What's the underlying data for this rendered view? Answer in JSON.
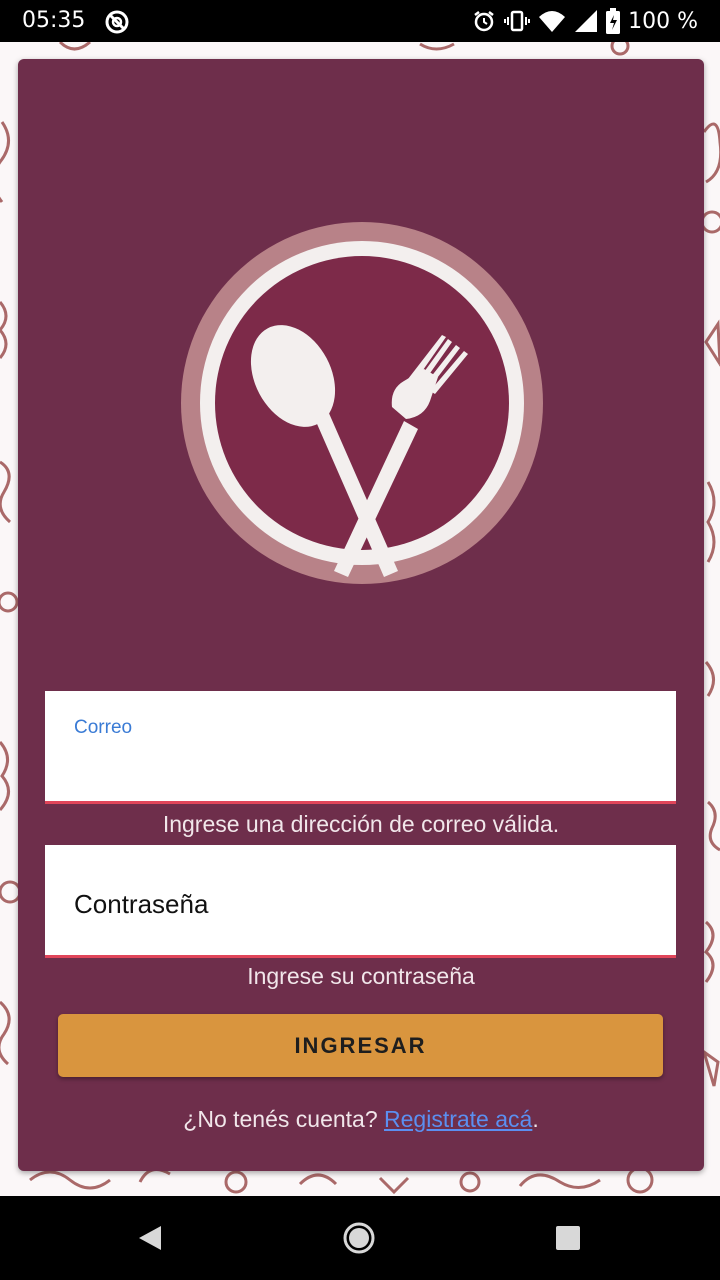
{
  "status_bar": {
    "time": "05:35",
    "battery_text": "100 %",
    "icons": [
      "do-not-disturb-icon",
      "alarm-icon",
      "vibrate-icon",
      "wifi-icon",
      "signal-icon",
      "battery-icon"
    ]
  },
  "logo": {
    "icon": "spoon-fork-plate-icon"
  },
  "form": {
    "email": {
      "label": "Correo",
      "value": "",
      "error": "Ingrese una dirección de correo válida."
    },
    "password": {
      "label": "Contraseña",
      "value": "",
      "error": "Ingrese su contraseña"
    },
    "login_button": "INGRESAR",
    "register_prompt": "¿No tenés cuenta? ",
    "register_link": "Registrate acá",
    "register_suffix": "."
  },
  "nav_bar": {
    "icons": [
      "back-icon",
      "home-icon",
      "recents-icon"
    ]
  },
  "colors": {
    "card": "#6e2e4b",
    "accent_button": "#d9953e",
    "label_blue": "#3a7bd5",
    "error_underline": "#e0455a",
    "link": "#5b8ff0",
    "logo_plate": "#7d2a49"
  }
}
